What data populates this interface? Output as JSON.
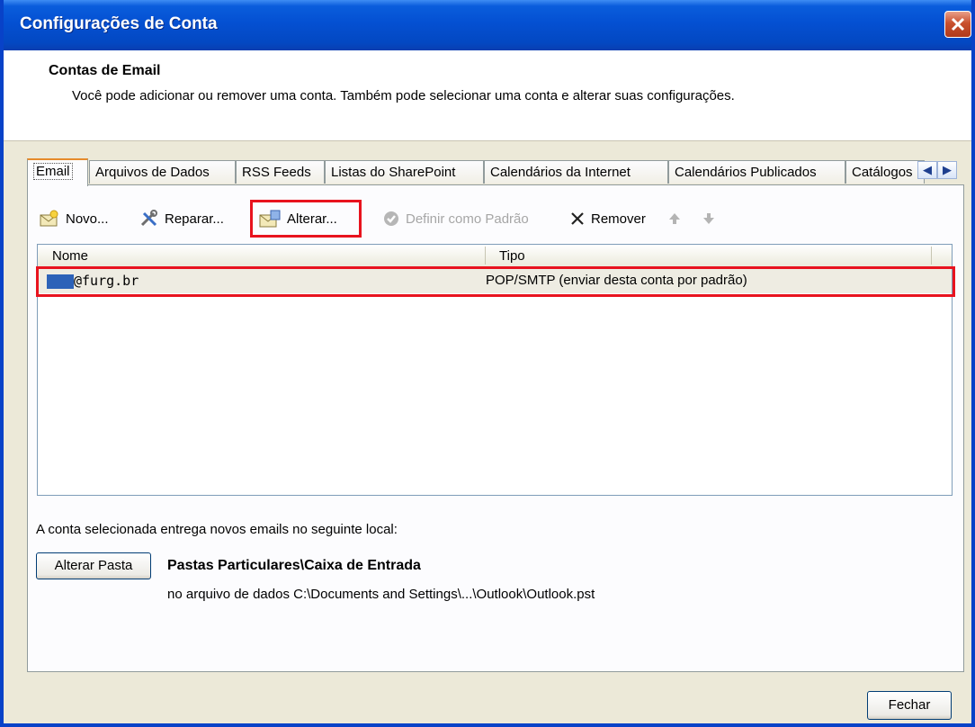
{
  "window": {
    "title": "Configurações de Conta"
  },
  "header": {
    "title": "Contas de Email",
    "description": "Você pode adicionar ou remover uma conta. Também pode selecionar uma conta e alterar suas configurações."
  },
  "tabs": [
    {
      "label": "Email",
      "active": true
    },
    {
      "label": "Arquivos de Dados"
    },
    {
      "label": "RSS Feeds"
    },
    {
      "label": "Listas do SharePoint"
    },
    {
      "label": "Calendários da Internet"
    },
    {
      "label": "Calendários Publicados"
    },
    {
      "label": "Catálogos"
    }
  ],
  "toolbar": {
    "new": "Novo...",
    "repair": "Reparar...",
    "change": "Alterar...",
    "set_default": "Definir como Padrão",
    "remove": "Remover"
  },
  "list": {
    "columns": [
      "Nome",
      "Tipo"
    ],
    "rows": [
      {
        "name": "@furg.br",
        "type": "POP/SMTP (enviar desta conta por padrão)"
      }
    ]
  },
  "delivery": {
    "label": "A conta selecionada entrega novos emails no seguinte local:",
    "change_folder_button": "Alterar Pasta",
    "folder": "Pastas Particulares\\Caixa de Entrada",
    "file_path": "no arquivo de dados C:\\Documents and Settings\\...\\Outlook\\Outlook.pst"
  },
  "footer": {
    "close_button": "Fechar"
  },
  "colors": {
    "title_bar": "#0450d2",
    "highlight": "#e8131e",
    "dialog_bg": "#ece9d8"
  }
}
